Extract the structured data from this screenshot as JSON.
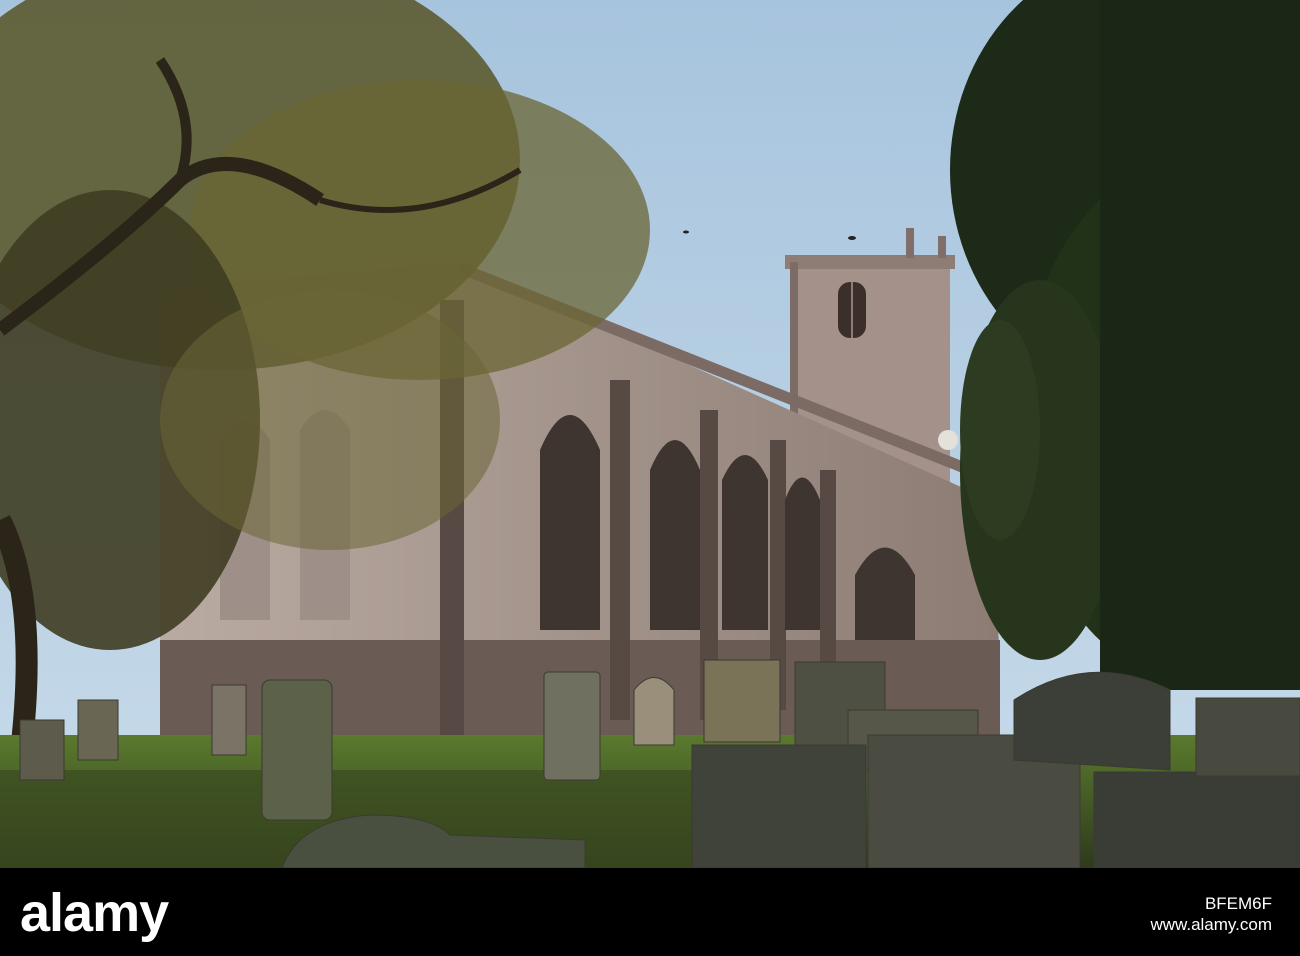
{
  "scene": {
    "subject": "church-with-tower-and-graveyard",
    "colors": {
      "sky": "#9ec0dc",
      "stone_lit": "#a8978f",
      "stone_shadow": "#5e504a",
      "foliage_dark": "#1f2a1a",
      "foliage_autumn": "#5f5a2a",
      "grass": "#4d6b2a",
      "headstone": "#6b6a5c"
    }
  },
  "watermark": {
    "logo_text": "alamy",
    "image_id": "BFEM6F",
    "url": "www.alamy.com"
  }
}
